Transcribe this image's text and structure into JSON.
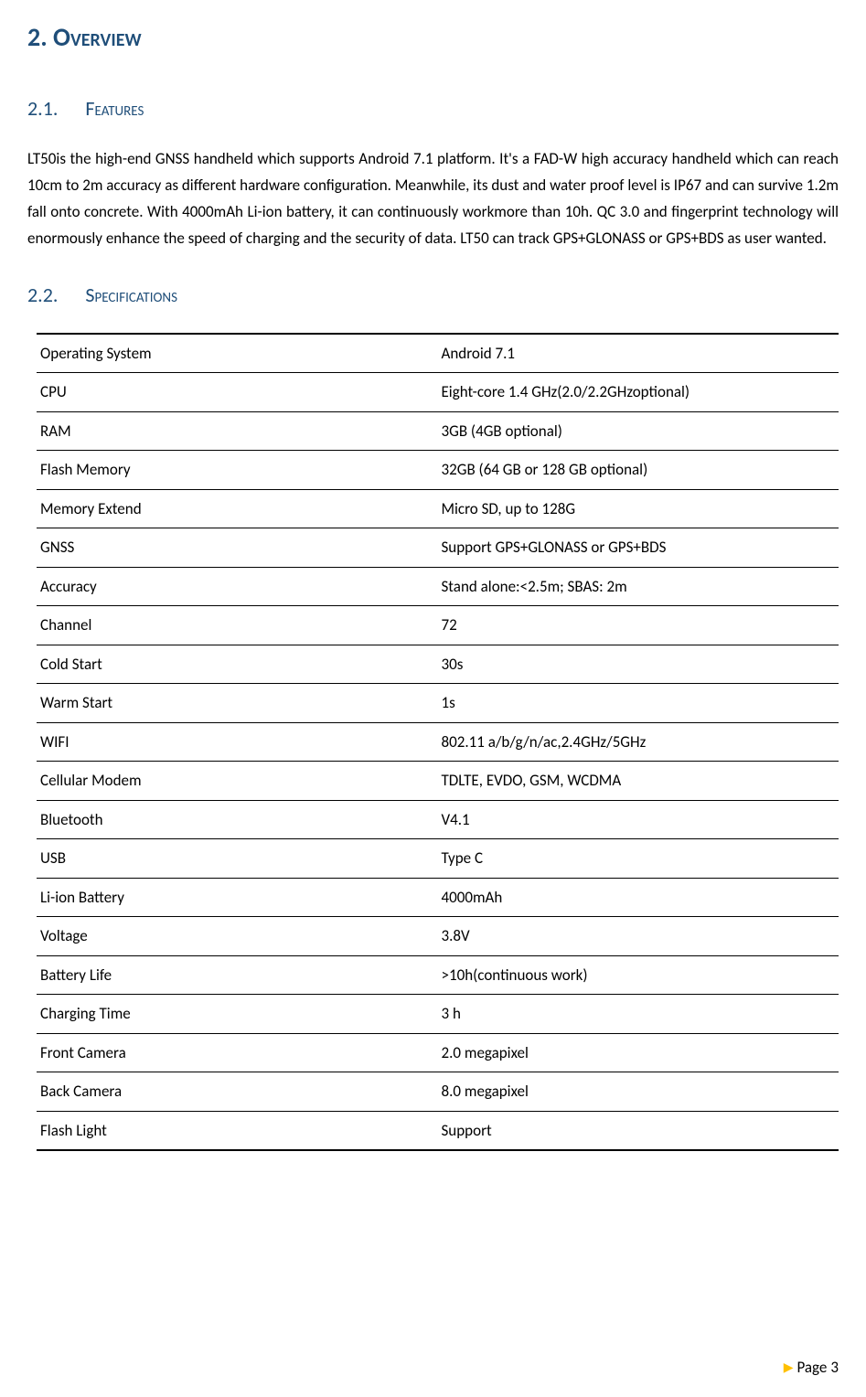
{
  "headings": {
    "h1_num": "2.",
    "h1_title": "Overview",
    "h2a_num": "2.1.",
    "h2a_title": "Features",
    "h2b_num": "2.2.",
    "h2b_title": "Specifications"
  },
  "features_body": "LT50is the high-end GNSS handheld which supports Android 7.1 platform. It's a FAD-W high accuracy handheld which can reach 10cm to 2m accuracy as different hardware configuration. Meanwhile, its dust and water proof level is IP67 and can survive 1.2m fall onto concrete. With 4000mAh Li-ion battery, it can continuously workmore than 10h. QC 3.0 and fingerprint technology will enormously enhance the speed of charging and the security of data. LT50 can track GPS+GLONASS or GPS+BDS as user wanted.",
  "specs": [
    {
      "k": "Operating System",
      "v": "Android 7.1"
    },
    {
      "k": "CPU",
      "v": "Eight-core 1.4 GHz(2.0/2.2GHzoptional)"
    },
    {
      "k": "RAM",
      "v": "3GB (4GB optional)"
    },
    {
      "k": "Flash Memory",
      "v": "32GB (64 GB or 128 GB optional)"
    },
    {
      "k": "Memory Extend",
      "v": "Micro SD, up to 128G"
    },
    {
      "k": "GNSS",
      "v": "Support GPS+GLONASS or GPS+BDS"
    },
    {
      "k": "Accuracy",
      "v": "Stand alone:<2.5m; SBAS: 2m"
    },
    {
      "k": "Channel",
      "v": "72"
    },
    {
      "k": "Cold Start",
      "v": "30s"
    },
    {
      "k": "Warm Start",
      "v": "1s"
    },
    {
      "k": "WIFI",
      "v": "802.11 a/b/g/n/ac,2.4GHz/5GHz"
    },
    {
      "k": "Cellular Modem",
      "v": "TDLTE, EVDO, GSM, WCDMA"
    },
    {
      "k": "Bluetooth",
      "v": "V4.1"
    },
    {
      "k": "USB",
      "v": "Type C"
    },
    {
      "k": "Li-ion Battery",
      "v": "4000mAh"
    },
    {
      "k": "Voltage",
      "v": "3.8V"
    },
    {
      "k": "Battery Life",
      "v": ">10h(continuous work)"
    },
    {
      "k": "Charging Time",
      "v": "3 h"
    },
    {
      "k": "Front Camera",
      "v": "2.0 megapixel"
    },
    {
      "k": "Back Camera",
      "v": "8.0 megapixel"
    },
    {
      "k": "Flash Light",
      "v": "Support"
    }
  ],
  "footer": {
    "label": "Page",
    "num": "3"
  }
}
